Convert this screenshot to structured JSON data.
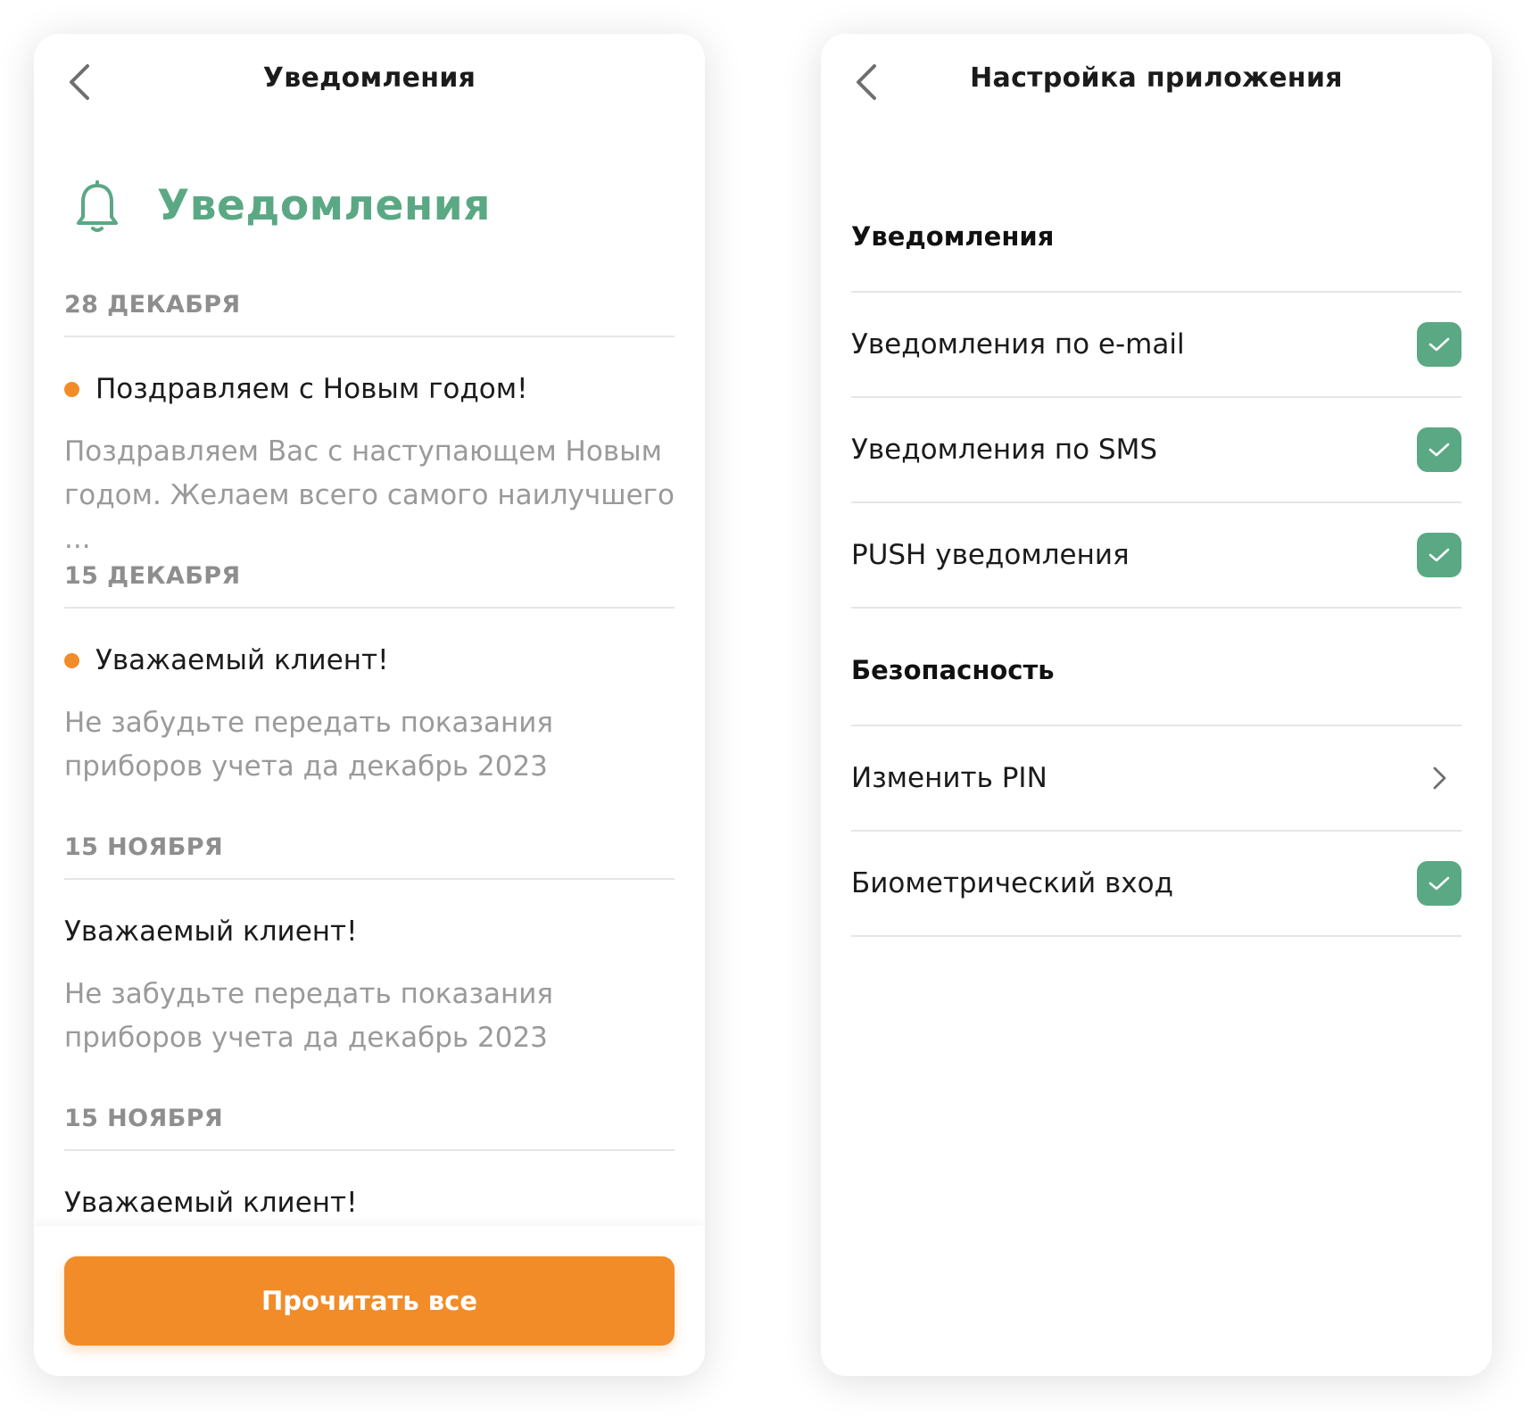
{
  "colors": {
    "accent_green": "#5ba884",
    "accent_orange": "#f28c28",
    "text_dark": "#1b1b1b",
    "text_muted": "#9a9a9a"
  },
  "notifications_screen": {
    "header_title": "Уведомления",
    "hero_icon": "bell-icon",
    "hero_title": "Уведомления",
    "groups": [
      {
        "date": "28 ДЕКАБРЯ",
        "title": "Поздравляем с Новым годом!",
        "body": "Поздравляем Вас с наступающем Новым годом. Желаем всего самого наилучшего ...",
        "unread": true
      },
      {
        "date": "15 ДЕКАБРЯ",
        "title": "Уважаемый клиент!",
        "body": "Не забудьте передать показания приборов учета да декабрь 2023",
        "unread": true
      },
      {
        "date": "15 НОЯБРЯ",
        "title": "Уважаемый клиент!",
        "body": "Не забудьте передать показания приборов учета да декабрь 2023",
        "unread": false
      },
      {
        "date": "15 НОЯБРЯ",
        "title": "Уважаемый клиент!",
        "body": "",
        "unread": false
      }
    ],
    "read_all_label": "Прочитать все"
  },
  "settings_screen": {
    "header_title": "Настройка приложения",
    "sections": [
      {
        "title": "Уведомления",
        "items": [
          {
            "label": "Уведомления по e-mail",
            "control": "checkbox",
            "checked": true
          },
          {
            "label": "Уведомления по SMS",
            "control": "checkbox",
            "checked": true
          },
          {
            "label": "PUSH уведомления",
            "control": "checkbox",
            "checked": true
          }
        ]
      },
      {
        "title": "Безопасность",
        "items": [
          {
            "label": "Изменить PIN",
            "control": "chevron"
          },
          {
            "label": "Биометрический вход",
            "control": "checkbox",
            "checked": true
          }
        ]
      }
    ]
  }
}
